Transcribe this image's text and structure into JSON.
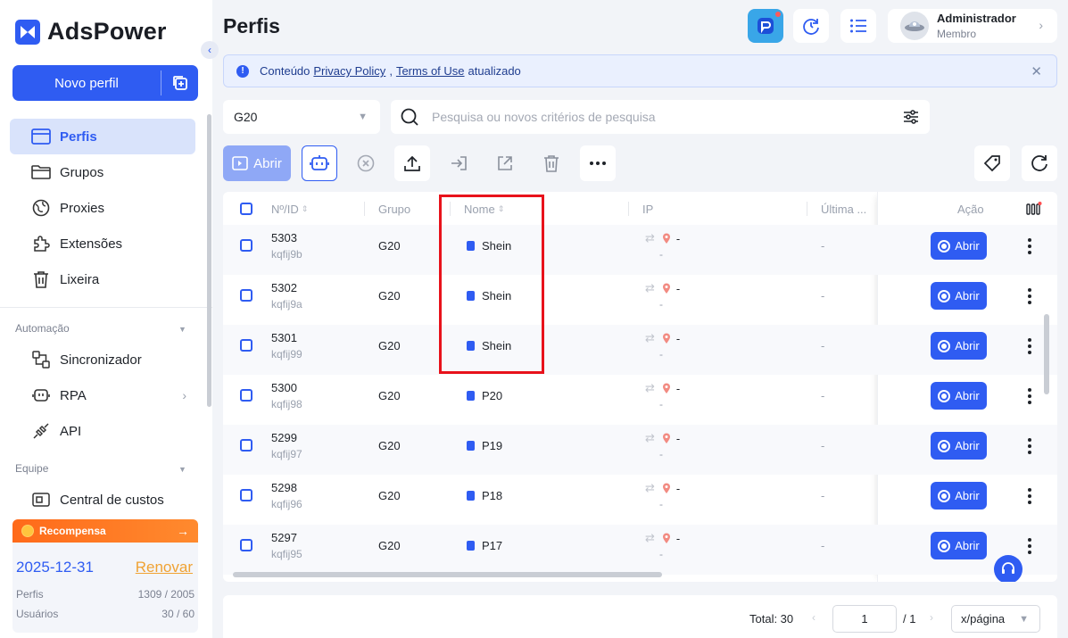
{
  "brand": {
    "name": "AdsPower"
  },
  "sidebar": {
    "new_profile": "Novo perfil",
    "items": [
      {
        "label": "Perfis",
        "icon": "profiles-icon"
      },
      {
        "label": "Grupos",
        "icon": "folder-icon"
      },
      {
        "label": "Proxies",
        "icon": "globe-icon"
      },
      {
        "label": "Extensões",
        "icon": "puzzle-icon"
      },
      {
        "label": "Lixeira",
        "icon": "trash-icon"
      }
    ],
    "automation_title": "Automação",
    "automation_items": [
      {
        "label": "Sincronizador",
        "icon": "sync-icon"
      },
      {
        "label": "RPA",
        "icon": "robot-icon"
      },
      {
        "label": "API",
        "icon": "plug-icon"
      }
    ],
    "team_title": "Equipe",
    "team_items": [
      {
        "label": "Central de custos",
        "icon": "cost-icon"
      }
    ],
    "reward": {
      "title": "Recompensa",
      "arrow": "→",
      "date": "2025-12-31",
      "renew": "Renovar",
      "profiles_label": "Perfis",
      "profiles_value": "1309 / 2005",
      "users_label": "Usuários",
      "users_value": "30 / 60"
    }
  },
  "header": {
    "title": "Perfis",
    "user_name": "Administrador",
    "user_role": "Membro"
  },
  "notice": {
    "prefix": "Conteúdo",
    "link1": "Privacy Policy",
    "sep": ",",
    "link2": "Terms of Use",
    "suffix": "atualizado"
  },
  "filters": {
    "group": "G20",
    "search_placeholder": "Pesquisa ou novos critérios de pesquisa"
  },
  "toolbar": {
    "open_label": "Abrir"
  },
  "table": {
    "headers": {
      "id": "Nº/ID",
      "group": "Grupo",
      "name": "Nome",
      "ip": "IP",
      "last": "Última ...",
      "action": "Ação"
    },
    "rows": [
      {
        "num": "5303",
        "id": "kqfij9b",
        "group": "G20",
        "name": "Shein",
        "ip": "-",
        "ip_sub": "-",
        "last": "-",
        "action": "Abrir"
      },
      {
        "num": "5302",
        "id": "kqfij9a",
        "group": "G20",
        "name": "Shein",
        "ip": "-",
        "ip_sub": "-",
        "last": "-",
        "action": "Abrir"
      },
      {
        "num": "5301",
        "id": "kqfij99",
        "group": "G20",
        "name": "Shein",
        "ip": "-",
        "ip_sub": "-",
        "last": "-",
        "action": "Abrir"
      },
      {
        "num": "5300",
        "id": "kqfij98",
        "group": "G20",
        "name": "P20",
        "ip": "-",
        "ip_sub": "-",
        "last": "-",
        "action": "Abrir"
      },
      {
        "num": "5299",
        "id": "kqfij97",
        "group": "G20",
        "name": "P19",
        "ip": "-",
        "ip_sub": "-",
        "last": "-",
        "action": "Abrir"
      },
      {
        "num": "5298",
        "id": "kqfij96",
        "group": "G20",
        "name": "P18",
        "ip": "-",
        "ip_sub": "-",
        "last": "-",
        "action": "Abrir"
      },
      {
        "num": "5297",
        "id": "kqfij95",
        "group": "G20",
        "name": "P17",
        "ip": "-",
        "ip_sub": "-",
        "last": "-",
        "action": "Abrir"
      }
    ]
  },
  "pagination": {
    "total": "Total: 30",
    "page": "1",
    "pages": "/ 1",
    "per_page": "x/página"
  },
  "colors": {
    "accent": "#2f5cf2",
    "highlight": "#e8121b",
    "reward": "#ff6a1a"
  }
}
